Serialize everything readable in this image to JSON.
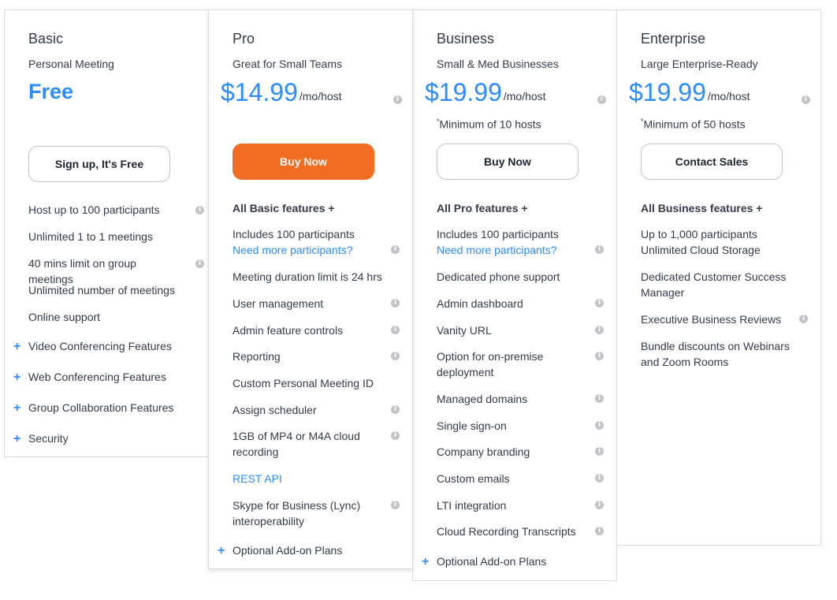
{
  "plans": {
    "basic": {
      "name": "Basic",
      "subtitle": "Personal Meeting",
      "price": "Free",
      "button": "Sign up, It's Free",
      "features": [
        "Host up to 100 participants",
        "Unlimited 1 to 1 meetings",
        "40 mins limit on group meetings",
        "Unlimited number of meetings",
        "Online support"
      ],
      "expandables": [
        "Video Conferencing Features",
        "Web Conferencing Features",
        "Group Collaboration Features",
        "Security"
      ]
    },
    "pro": {
      "name": "Pro",
      "subtitle": "Great for Small Teams",
      "price": "$14.99",
      "unit": "/mo/host",
      "button": "Buy Now",
      "header": "All Basic features +",
      "participants": "Includes 100 participants",
      "participants_link": "Need more participants?",
      "features": [
        "Meeting duration limit is 24 hrs",
        "User management",
        "Admin feature controls",
        "Reporting",
        "Custom Personal Meeting ID",
        "Assign scheduler",
        "1GB of MP4 or M4A cloud recording",
        "REST API",
        "Skype for Business (Lync) interoperability"
      ],
      "addon": "Optional Add-on Plans"
    },
    "business": {
      "name": "Business",
      "subtitle": "Small & Med Businesses",
      "price": "$19.99",
      "unit": "/mo/host",
      "minimum_mark": "*",
      "minimum": "Minimum of 10 hosts",
      "button": "Buy Now",
      "header": "All Pro features +",
      "participants": "Includes 100 participants",
      "participants_link": "Need more participants?",
      "features": [
        "Dedicated phone support",
        "Admin dashboard",
        "Vanity URL",
        "Option for on-premise deployment",
        "Managed domains",
        "Single sign-on",
        "Company branding",
        "Custom emails",
        "LTI integration",
        "Cloud Recording Transcripts"
      ],
      "addon": "Optional Add-on Plans"
    },
    "enterprise": {
      "name": "Enterprise",
      "subtitle": "Large Enterprise-Ready",
      "price": "$19.99",
      "unit": "/mo/host",
      "minimum_mark": "*",
      "minimum": "Minimum of 50 hosts",
      "button": "Contact Sales",
      "header": "All Business features +",
      "features": [
        "Up to 1,000 participants",
        "Unlimited Cloud Storage",
        "Dedicated Customer Success Manager",
        "Executive Business Reviews",
        "Bundle discounts on Webinars and Zoom Rooms"
      ]
    }
  },
  "colors": {
    "accent": "#2d8cff",
    "buy": "#f26d21",
    "border": "#dcdde2"
  },
  "icons": {
    "info": "info-icon",
    "plus": "plus-icon"
  }
}
